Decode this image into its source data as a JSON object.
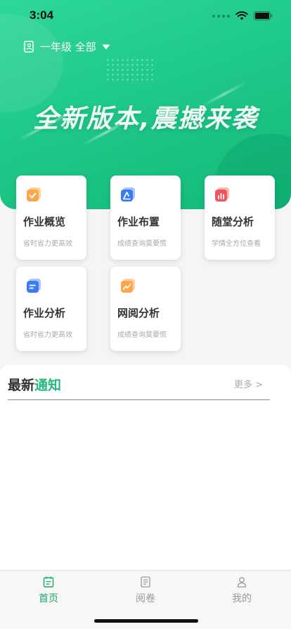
{
  "status_bar": {
    "time": "3:04"
  },
  "header": {
    "grade_selector_label": "一年级 全部",
    "slogan": "全新版本,震撼来袭"
  },
  "cards": [
    {
      "title": "作业概览",
      "subtitle": "省时省力更高效",
      "icon": "homework-overview-icon",
      "accent": "#ffa54a"
    },
    {
      "title": "作业布置",
      "subtitle": "成绩查询莫要慌",
      "icon": "assign-homework-icon",
      "accent": "#3a7bf5"
    },
    {
      "title": "随堂分析",
      "subtitle": "学情全方位查看",
      "icon": "classroom-analysis-icon",
      "accent": "#f0545c"
    },
    {
      "title": "作业分析",
      "subtitle": "省时省力更高效",
      "icon": "homework-analysis-icon",
      "accent": "#3a7bf5"
    },
    {
      "title": "网阅分析",
      "subtitle": "成绩查询莫要慌",
      "icon": "online-marking-icon",
      "accent": "#ffa54a"
    }
  ],
  "notice": {
    "title_part1": "最新",
    "title_part2": "通知",
    "more_label": "更多 >"
  },
  "tabs": [
    {
      "label": "首页",
      "icon": "home-icon",
      "active": true
    },
    {
      "label": "阅卷",
      "icon": "marking-icon",
      "active": false
    },
    {
      "label": "我的",
      "icon": "profile-icon",
      "active": false
    }
  ],
  "colors": {
    "primary": "#1fc98a",
    "active_tab": "#1aa86b",
    "notice_accent": "#25b97a"
  }
}
